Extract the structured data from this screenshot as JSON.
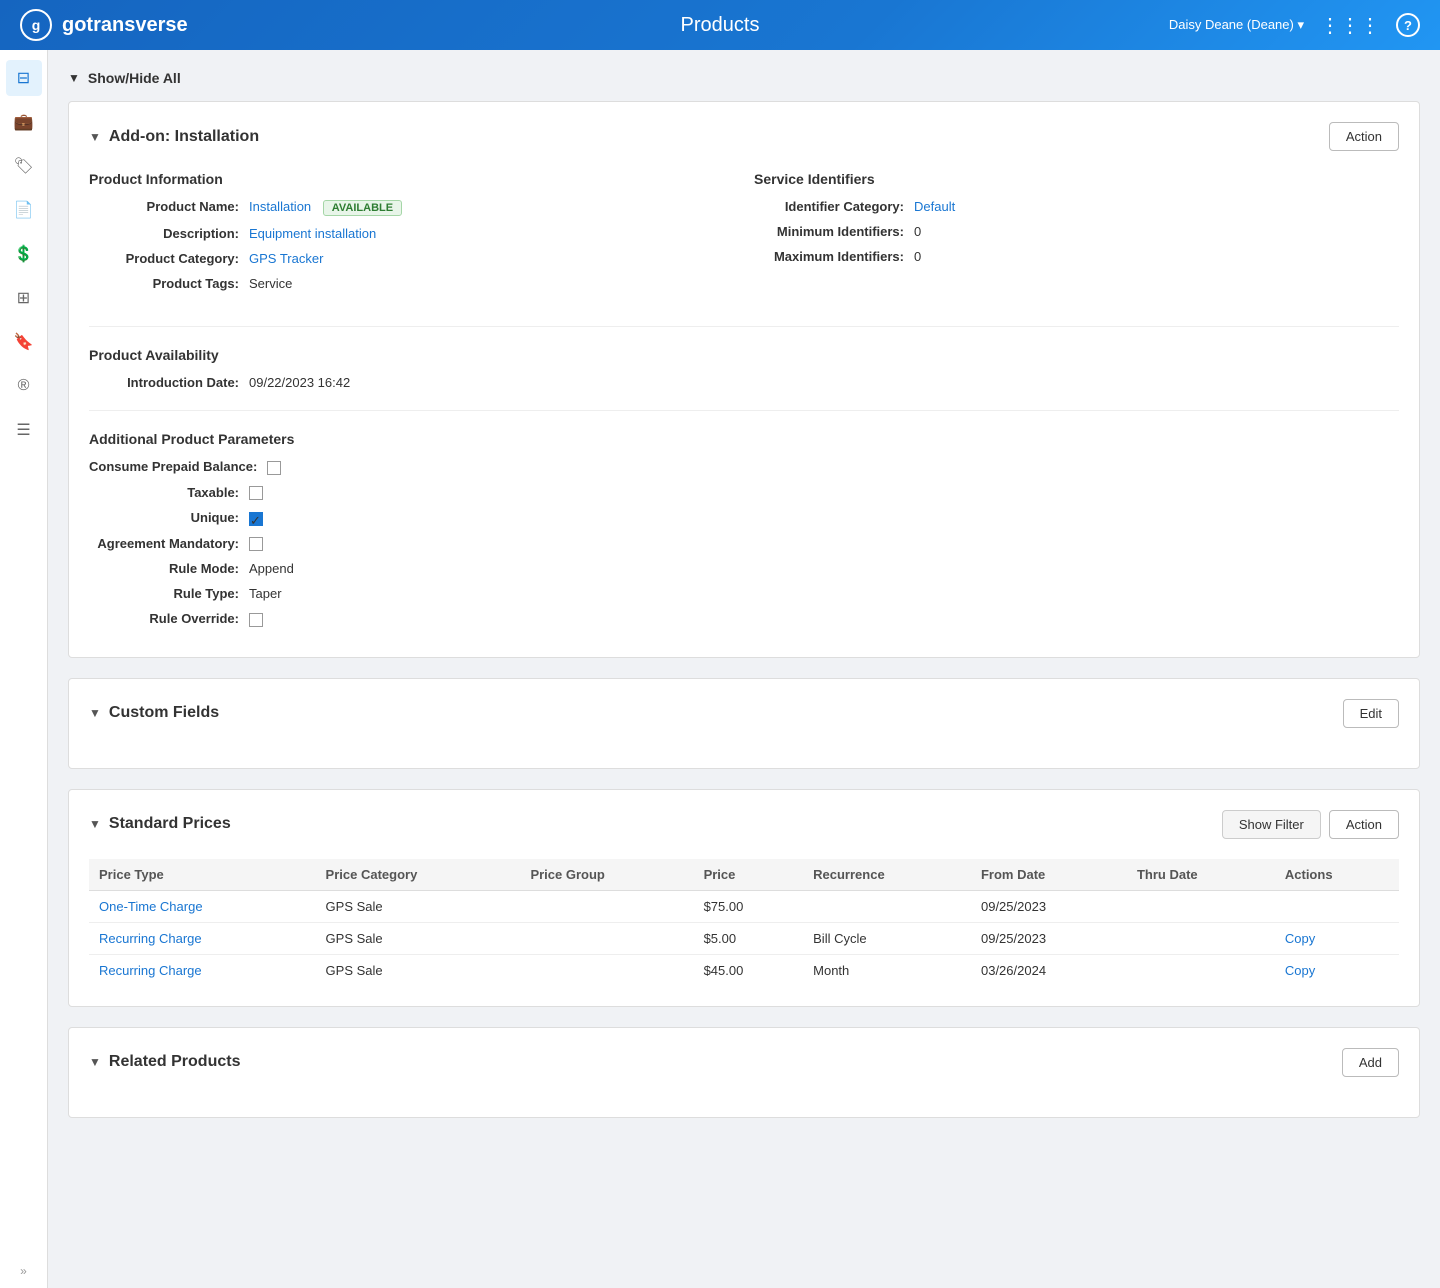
{
  "navbar": {
    "logo_text": "g",
    "brand_name": "gotransverse",
    "page_title": "Products",
    "user_label": "Daisy Deane (Deane) ▾",
    "help_label": "?"
  },
  "sidebar": {
    "items": [
      {
        "name": "dashboard-icon",
        "icon": "⊟",
        "active": true
      },
      {
        "name": "briefcase-icon",
        "icon": "💼",
        "active": false
      },
      {
        "name": "tag-icon",
        "icon": "🏷",
        "active": false
      },
      {
        "name": "document-icon",
        "icon": "📄",
        "active": false
      },
      {
        "name": "dollar-icon",
        "icon": "💲",
        "active": false
      },
      {
        "name": "grid-icon",
        "icon": "⊞",
        "active": false
      },
      {
        "name": "tag2-icon",
        "icon": "🔖",
        "active": false
      },
      {
        "name": "registered-icon",
        "icon": "®",
        "active": false
      },
      {
        "name": "list-icon",
        "icon": "☰",
        "active": false
      }
    ],
    "expand_label": "»"
  },
  "show_hide_all": {
    "label": "Show/Hide All"
  },
  "addon_section": {
    "title": "Add-on: Installation",
    "action_button": "Action",
    "product_info": {
      "section_title": "Product Information",
      "fields": [
        {
          "label": "Product Name:",
          "value": "Installation",
          "extra": "AVAILABLE",
          "type": "name_badge"
        },
        {
          "label": "Description:",
          "value": "Equipment installation",
          "type": "link"
        },
        {
          "label": "Product Category:",
          "value": "GPS Tracker",
          "type": "link"
        },
        {
          "label": "Product Tags:",
          "value": "Service",
          "type": "text"
        }
      ]
    },
    "service_identifiers": {
      "section_title": "Service Identifiers",
      "fields": [
        {
          "label": "Identifier Category:",
          "value": "Default",
          "type": "link"
        },
        {
          "label": "Minimum Identifiers:",
          "value": "0",
          "type": "text"
        },
        {
          "label": "Maximum Identifiers:",
          "value": "0",
          "type": "text"
        }
      ]
    },
    "product_availability": {
      "section_title": "Product Availability",
      "fields": [
        {
          "label": "Introduction Date:",
          "value": "09/22/2023 16:42",
          "type": "text"
        }
      ]
    },
    "additional_params": {
      "section_title": "Additional Product Parameters",
      "fields": [
        {
          "label": "Consume Prepaid Balance:",
          "type": "checkbox",
          "checked": false
        },
        {
          "label": "Taxable:",
          "type": "checkbox",
          "checked": false
        },
        {
          "label": "Unique:",
          "type": "checkbox",
          "checked": true
        },
        {
          "label": "Agreement Mandatory:",
          "type": "checkbox",
          "checked": false
        },
        {
          "label": "Rule Mode:",
          "value": "Append",
          "type": "text"
        },
        {
          "label": "Rule Type:",
          "value": "Taper",
          "type": "text"
        },
        {
          "label": "Rule Override:",
          "type": "checkbox",
          "checked": false
        }
      ]
    }
  },
  "custom_fields_section": {
    "title": "Custom Fields",
    "edit_button": "Edit"
  },
  "standard_prices_section": {
    "title": "Standard Prices",
    "show_filter_button": "Show Filter",
    "action_button": "Action",
    "table": {
      "headers": [
        "Price Type",
        "Price Category",
        "Price Group",
        "Price",
        "Recurrence",
        "From Date",
        "Thru Date",
        "Actions"
      ],
      "rows": [
        {
          "price_type": "One-Time Charge",
          "price_category": "GPS Sale",
          "price_group": "",
          "price": "$75.00",
          "recurrence": "",
          "from_date": "09/25/2023",
          "thru_date": "",
          "actions": ""
        },
        {
          "price_type": "Recurring Charge",
          "price_category": "GPS Sale",
          "price_group": "",
          "price": "$5.00",
          "recurrence": "Bill Cycle",
          "from_date": "09/25/2023",
          "thru_date": "",
          "actions": "Copy"
        },
        {
          "price_type": "Recurring Charge",
          "price_category": "GPS Sale",
          "price_group": "",
          "price": "$45.00",
          "recurrence": "Month",
          "from_date": "03/26/2024",
          "thru_date": "",
          "actions": "Copy"
        }
      ]
    }
  },
  "related_products_section": {
    "title": "Related Products",
    "add_button": "Add"
  }
}
